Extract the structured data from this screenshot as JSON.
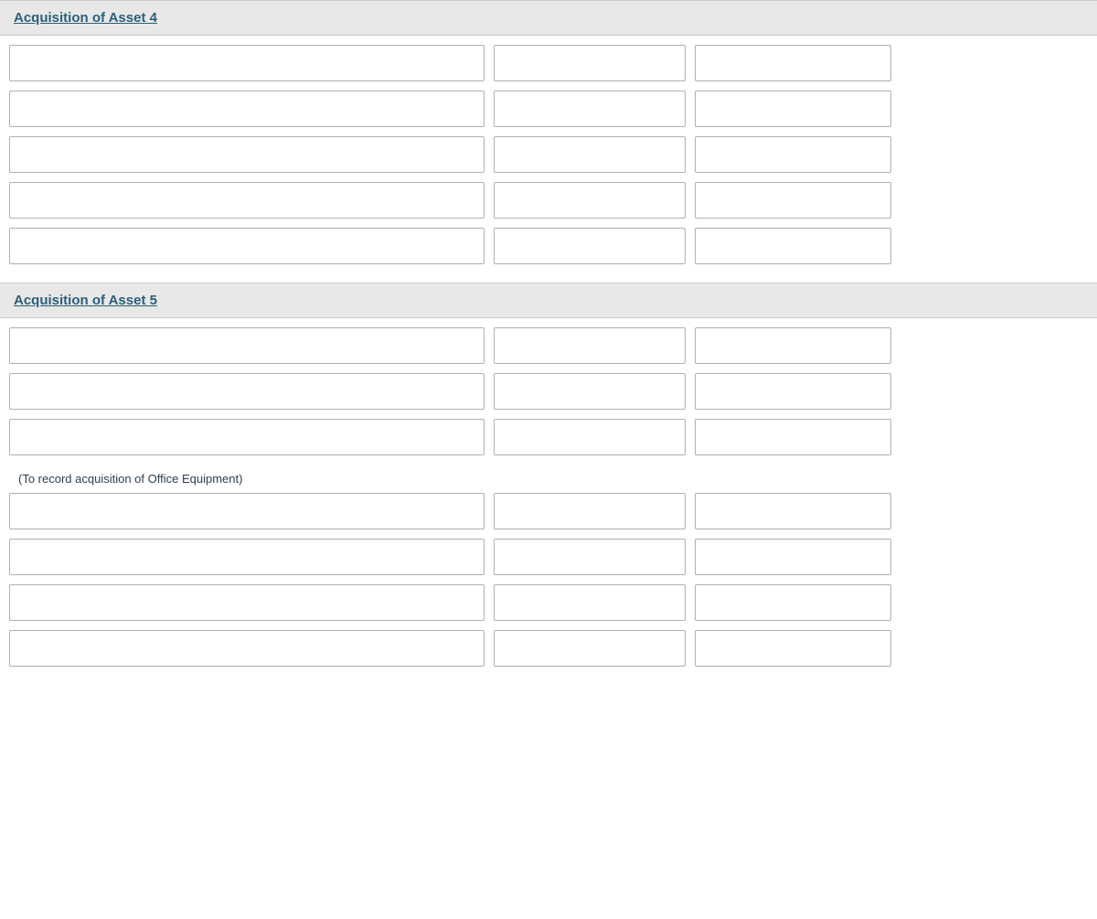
{
  "sections": [
    {
      "id": "asset4",
      "title": "Acquisition of Asset 4",
      "rows_before_note": 5,
      "note": null,
      "rows_after_note": 0
    },
    {
      "id": "asset5",
      "title": "Acquisition of Asset 5",
      "rows_before_note": 3,
      "note": "(To record acquisition of Office Equipment)",
      "rows_after_note": 4
    }
  ],
  "labels": {
    "asset4_title": "Acquisition of Asset 4",
    "asset5_title": "Acquisition of Asset 5",
    "note_text": "(To record acquisition of Office Equipment)"
  }
}
